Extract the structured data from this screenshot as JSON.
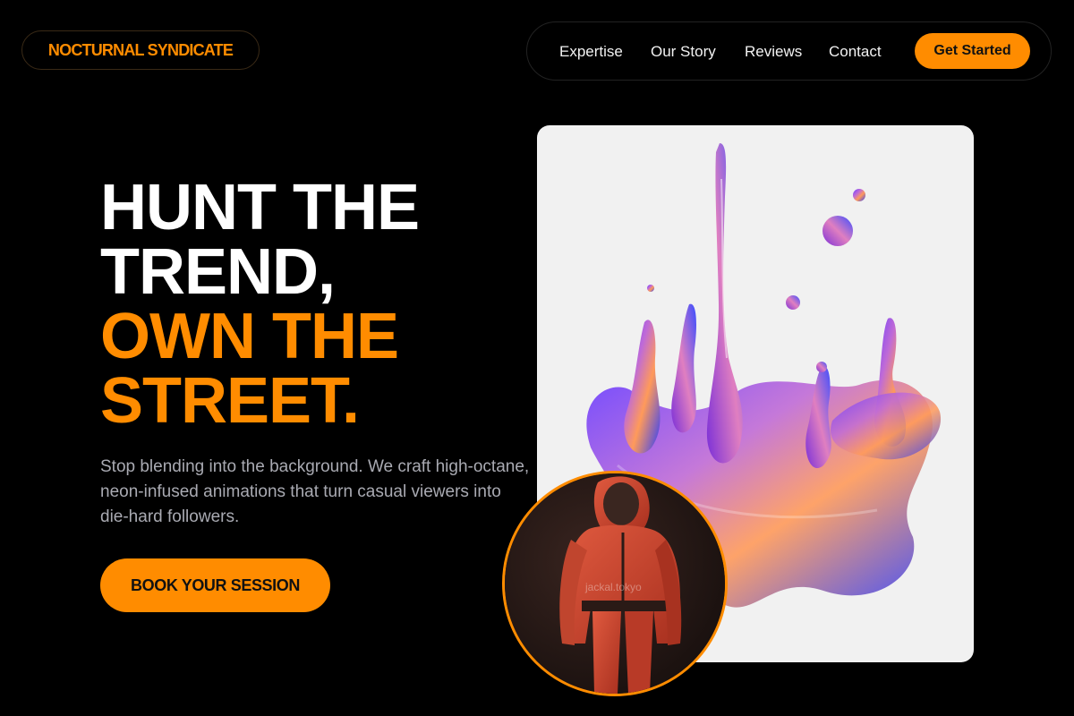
{
  "brand": {
    "name": "NOCTURNAL SYNDICATE"
  },
  "nav": {
    "links": [
      "Expertise",
      "Our Story",
      "Reviews",
      "Contact"
    ],
    "cta": "Get Started"
  },
  "hero": {
    "line1": "HUNT THE",
    "line2": "TREND,",
    "line3": "OWN THE",
    "line4": "STREET.",
    "subtext": "Stop blending into the background. We craft high-octane, neon-infused animations that turn casual viewers into die-hard followers.",
    "button": "BOOK YOUR SESSION"
  },
  "avatar": {
    "watermark": "jackal.tokyo"
  },
  "colors": {
    "accent": "#ff8c00",
    "background": "#000000",
    "card": "#f1f1f1"
  }
}
